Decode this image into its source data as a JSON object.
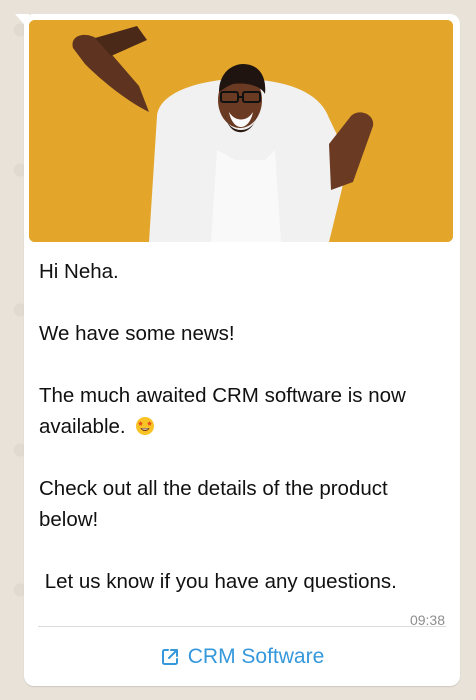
{
  "message": {
    "greeting": "Hi Neha.",
    "line_news": "We have some news!",
    "line_software_1": "The much awaited CRM software is now",
    "line_software_2": "available.",
    "line_details_1": "Check out all the details of the product",
    "line_details_2": "below!",
    "line_questions": " Let us know if you have any questions.",
    "time": "09:38"
  },
  "button": {
    "label": "CRM Software",
    "icon": "external-link-icon"
  },
  "colors": {
    "accent": "#3598db",
    "photo_background": "#e3a62a",
    "bubble": "#ffffff",
    "wallpaper": "#e8e2d9"
  }
}
